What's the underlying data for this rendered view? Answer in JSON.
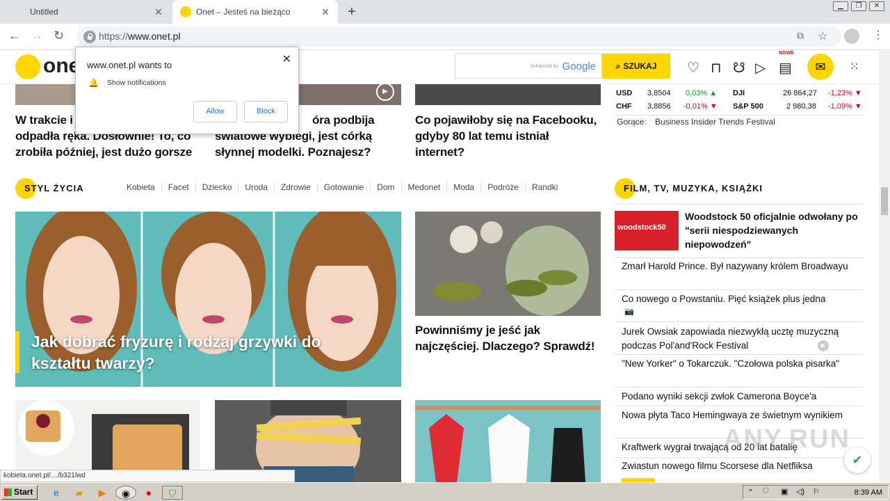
{
  "browser": {
    "tabs": [
      {
        "title": "Untitled"
      },
      {
        "title": "Onet – Jesteś na bieżąco"
      }
    ],
    "url_proto": "https://",
    "url_host": "www.onet.pl"
  },
  "site": {
    "logo": "onet",
    "search": {
      "enhanced": "enhanced by",
      "google": "Google",
      "button": "SZUKAJ"
    },
    "nowe": "NOWE"
  },
  "top_headlines": [
    "W trakcie i… odpadła ręka. Dosłownie! To, co zrobiła później, jest dużo gorsze",
    "…óra podbija światowe wybiegi, jest córką słynnej modelki. Poznajesz?",
    "Co pojawiłoby się na Facebooku, gdyby 80 lat temu istniał internet?"
  ],
  "top_headline_lines": {
    "a": [
      "W trakcie i",
      "odpadła ręka. Dosłownie! To, co",
      "zrobiła później, jest dużo gorsze"
    ],
    "b": [
      "óra podbija",
      "światowe wybiegi, jest córką",
      "słynnej modelki. Poznajesz?"
    ],
    "c": [
      "Co pojawiłoby się na Facebooku,",
      "gdyby 80 lat temu istniał",
      "internet?"
    ]
  },
  "finance": {
    "rows": [
      {
        "sym": "USD",
        "val": "3,8504",
        "chg": "0,03%",
        "dir": "up",
        "sym2": "DJI",
        "val2": "26 864,27",
        "chg2": "-1,23%",
        "dir2": "down"
      },
      {
        "sym": "CHF",
        "val": "3,8856",
        "chg": "-0,01%",
        "dir": "down",
        "sym2": "S&P 500",
        "val2": "2 980,38",
        "chg2": "-1,09%",
        "dir2": "down"
      }
    ],
    "hot_label": "Gorące:",
    "hot_value": "Business Insider Trends Festival"
  },
  "styl": {
    "title": "STYL ŻYCIA",
    "nav": [
      "Kobieta",
      "Facet",
      "Dziecko",
      "Uroda",
      "Zdrowie",
      "Gotowanie",
      "Dom",
      "Medonet",
      "Moda",
      "Podróże",
      "Randki"
    ],
    "hero_caption": "Jak dobrać fryzurę i rodzaj grzywki do kształtu twarzy?",
    "side_caption": "Powinniśmy je jeść jak najczęściej. Dlaczego? Sprawdź!"
  },
  "film": {
    "title": "FILM, TV, MUZYKA, KSIĄŻKI",
    "lead": "Woodstock 50 oficjalnie odwołany po \"serii niespodziewanych niepowodzeń\"",
    "lead_img_text": "woodstock50",
    "items": [
      "Zmarł Harold Prince. Był nazywany królem Broadwayu",
      "Co nowego o Powstaniu. Pięć książek plus jedna",
      "Jurek Owsiak zapowiada niezwykłą ucztę muzyczną podczas Pol'and'Rock Festival",
      "\"New Yorker\" o Tokarczuk. \"Czołowa polska pisarka\"",
      "Podano wyniki sekcji zwłok Camerona Boyce'a",
      "Nowa płyta Taco Hemingwaya ze świetnym wynikiem",
      "Kraftwerk wygrał trwającą od 20 lat batalię",
      "Zwiastun nowego filmu Scorsese dla Netfliksa"
    ]
  },
  "popup": {
    "title": "www.onet.pl wants to",
    "text": "Show notifications",
    "allow": "Allow",
    "block": "Block"
  },
  "status_url": "kobieta.onet.pl/…/b321lwd",
  "watermark": "ANY.RUN",
  "taskbar": {
    "start": "Start",
    "time": "8:39 AM"
  }
}
